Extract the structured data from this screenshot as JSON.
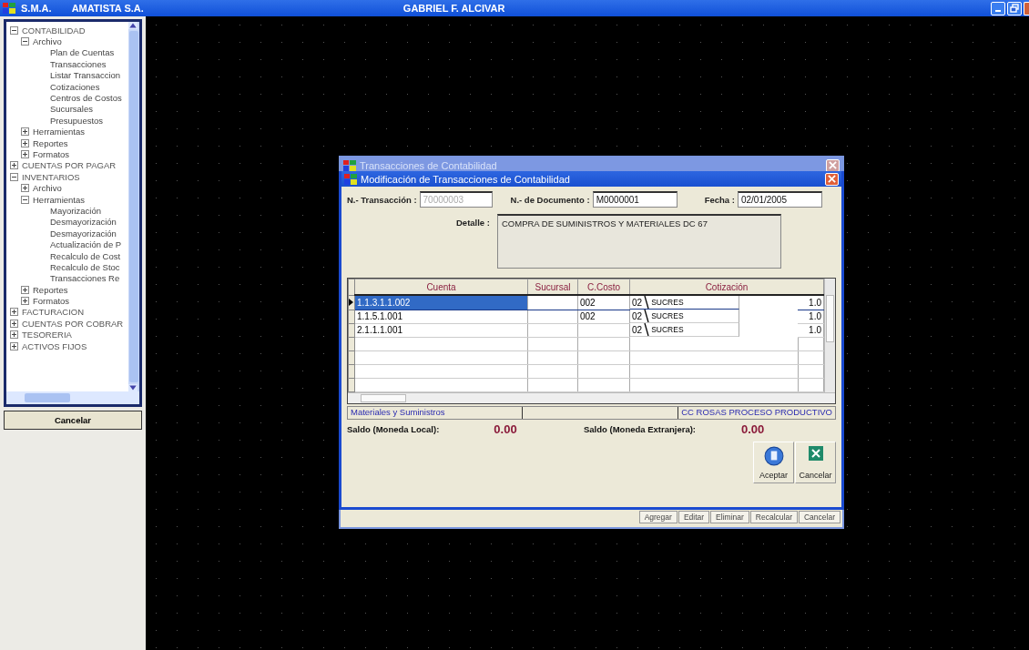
{
  "app_bar": {
    "system": "S.M.A.",
    "company": "AMATISTA S.A.",
    "user": "GABRIEL F. ALCIVAR"
  },
  "sidebar": {
    "tree": [
      {
        "label": "CONTABILIDAD",
        "expanded": true,
        "children": [
          {
            "label": "Archivo",
            "expanded": true,
            "children": [
              {
                "label": "Plan de Cuentas"
              },
              {
                "label": "Transacciones"
              },
              {
                "label": "Listar Transaccion"
              },
              {
                "label": "Cotizaciones"
              },
              {
                "label": "Centros de Costos"
              },
              {
                "label": "Sucursales"
              },
              {
                "label": "Presupuestos"
              }
            ]
          },
          {
            "label": "Herramientas",
            "expanded": false
          },
          {
            "label": "Reportes",
            "expanded": false
          },
          {
            "label": "Formatos",
            "expanded": false
          }
        ]
      },
      {
        "label": "CUENTAS POR PAGAR",
        "expanded": false
      },
      {
        "label": "INVENTARIOS",
        "expanded": true,
        "children": [
          {
            "label": "Archivo",
            "expanded": false
          },
          {
            "label": "Herramientas",
            "expanded": true,
            "children": [
              {
                "label": "Mayorización"
              },
              {
                "label": "Desmayorización"
              },
              {
                "label": "Desmayorización"
              },
              {
                "label": "Actualización de P"
              },
              {
                "label": "Recalculo de Cost"
              },
              {
                "label": "Recalculo de Stoc"
              },
              {
                "label": "Transacciones Re"
              }
            ]
          },
          {
            "label": "Reportes",
            "expanded": false
          },
          {
            "label": "Formatos",
            "expanded": false
          }
        ]
      },
      {
        "label": "FACTURACION",
        "expanded": false
      },
      {
        "label": "CUENTAS POR COBRAR",
        "expanded": false
      },
      {
        "label": "TESORERIA",
        "expanded": false
      },
      {
        "label": "ACTIVOS FIJOS",
        "expanded": false
      }
    ],
    "cancel_button": "Cancelar"
  },
  "back_window": {
    "title": "Transacciones de Contabilidad",
    "buttons": [
      "Agregar",
      "Editar",
      "Eliminar",
      "Recalcular",
      "Cancelar"
    ]
  },
  "dialog": {
    "title": "Modificación de Transacciones de Contabilidad",
    "fields": [
      {
        "label": "N.- Transacción :",
        "value": "70000003",
        "disabled": true
      },
      {
        "label": "N.- de Documento :",
        "value": "M0000001",
        "disabled": false
      },
      {
        "label": "Fecha :",
        "value": "02/01/2005",
        "disabled": false
      }
    ],
    "detail": {
      "label": "Detalle :",
      "value": "COMPRA DE SUMINISTROS Y MATERIALES DC 67"
    },
    "table": {
      "columns": [
        "Cuenta",
        "Sucursal",
        "C.Costo",
        "Cotización"
      ],
      "rows": [
        {
          "cuenta": "1.1.3.1.1.002",
          "sucursal": "",
          "costo": "002",
          "moneda": "02",
          "moneda_nombre": "SUCRES",
          "cotizacion": "1.0",
          "selected": true
        },
        {
          "cuenta": "1.1.5.1.001",
          "sucursal": "",
          "costo": "002",
          "moneda": "02",
          "moneda_nombre": "SUCRES",
          "cotizacion": "1.0",
          "selected": false
        },
        {
          "cuenta": "2.1.1.1.001",
          "sucursal": "",
          "costo": "",
          "moneda": "02",
          "moneda_nombre": "SUCRES",
          "cotizacion": "1.0",
          "selected": false
        }
      ]
    },
    "status": [
      "Materiales y Suministros",
      "CC ROSAS PROCESO PRODUCTIVO"
    ],
    "balances": [
      {
        "label": "Saldo (Moneda Local):",
        "value": "0.00"
      },
      {
        "label": "Saldo (Moneda Extranjera):",
        "value": "0.00"
      }
    ],
    "buttons": [
      {
        "label": "Aceptar",
        "kind": "accept"
      },
      {
        "label": "Cancelar",
        "kind": "cancel"
      }
    ]
  }
}
